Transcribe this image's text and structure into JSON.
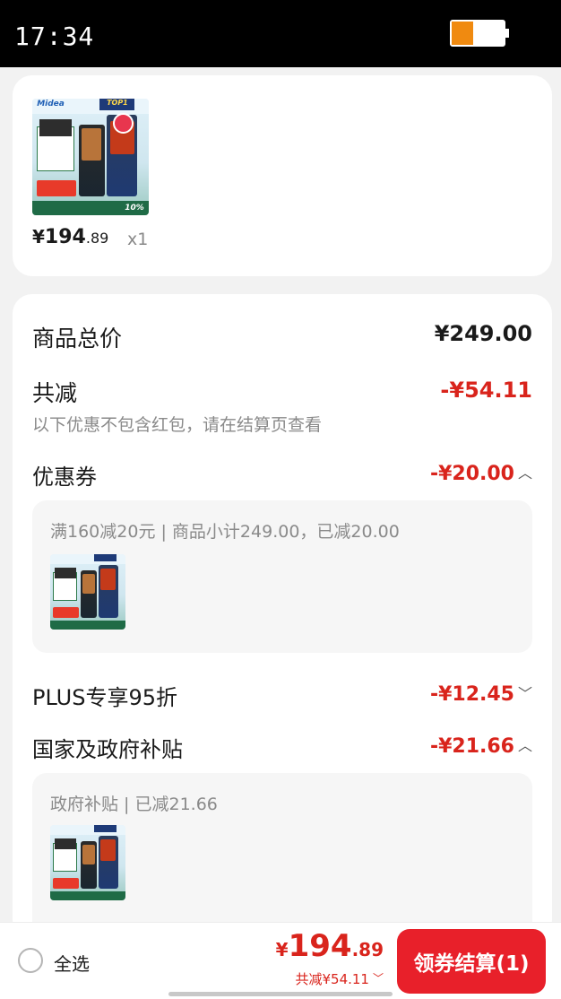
{
  "status_bar": {
    "time": "17:34",
    "battery_level": 0.42,
    "battery_color": "#f08a10"
  },
  "product": {
    "image_brand": "Midea",
    "image_badge": "TOP1",
    "image_discount": "10%",
    "price_yen": "¥",
    "price_int": "194",
    "price_dec": ".89",
    "quantity": "x1"
  },
  "summary": {
    "total_label": "商品总价",
    "total_value": "¥249.00",
    "reduce_label": "共减",
    "reduce_value": "-¥54.11",
    "reduce_note": "以下优惠不包含红包，请在结算页查看",
    "coupon_label": "优惠券",
    "coupon_value": "-¥20.00",
    "coupon_detail": "满160减20元 | 商品小计249.00，已减20.00",
    "plus_label": "PLUS专享95折",
    "plus_value": "-¥12.45",
    "gov_label": "国家及政府补贴",
    "gov_value": "-¥21.66",
    "gov_detail": "政府补贴 | 已减21.66"
  },
  "bottom": {
    "select_all": "全选",
    "total_yen": "¥",
    "total_int": "194",
    "total_dec": ".89",
    "total_reduce": "共减¥54.11",
    "checkout": "领券结算(1)"
  },
  "colors": {
    "accent_red": "#d9241c",
    "button_red": "#e8202a"
  }
}
